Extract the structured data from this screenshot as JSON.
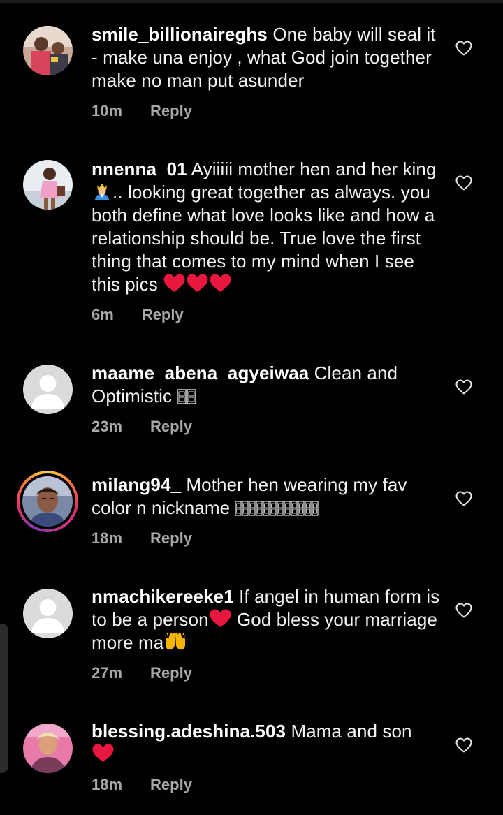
{
  "theme": {
    "background": "#000000",
    "username_color": "#ffffff",
    "meta_color": "#a8a8a8",
    "heart_color": "#e8173f",
    "story_ring": [
      "#ffcf40",
      "#f77737",
      "#e1306c",
      "#c13584",
      "#833ab4"
    ]
  },
  "comments": [
    {
      "username": "smile_billionaireghs",
      "text": "One baby will seal it -  make una enjoy , what God join together make no man put asunder",
      "time": "10m",
      "reply_label": "Reply",
      "avatar": "photo-two-men",
      "like_icon": "heart-outline-icon"
    },
    {
      "username": "nnenna_01",
      "text_parts": [
        "Ayiiiii mother hen and her king",
        ".. looking great together as always. you both define what love looks like and how a relationship should be. True love the first thing that comes to my mind when I see this pics "
      ],
      "emojis": [
        "prince-emoji",
        "red-heart-emoji",
        "red-heart-emoji",
        "red-heart-emoji"
      ],
      "time": "6m",
      "reply_label": "Reply",
      "avatar": "photo-woman-pink",
      "like_icon": "heart-outline-icon"
    },
    {
      "username": "maame_abena_agyeiwaa",
      "text": "Clean and Optimistic ",
      "emojis": [
        "missing-glyph",
        "missing-glyph"
      ],
      "time": "23m",
      "reply_label": "Reply",
      "avatar": "default-avatar",
      "like_icon": "heart-outline-icon"
    },
    {
      "username": "milang94_",
      "text": "Mother hen wearing my fav color n nickname ",
      "emojis": [
        "missing-glyph",
        "missing-glyph",
        "missing-glyph",
        "missing-glyph",
        "missing-glyph",
        "missing-glyph",
        "missing-glyph",
        "missing-glyph",
        "missing-glyph",
        "missing-glyph",
        "missing-glyph",
        "missing-glyph"
      ],
      "time": "18m",
      "reply_label": "Reply",
      "avatar": "photo-woman-selfie",
      "has_story": true,
      "like_icon": "heart-outline-icon"
    },
    {
      "username": "nmachikereeke1",
      "text_parts": [
        "If angel in human form is to be a person",
        " God bless your marriage more ma"
      ],
      "emojis": [
        "red-heart-emoji",
        "raising-hands-emoji"
      ],
      "time": "27m",
      "reply_label": "Reply",
      "avatar": "default-avatar",
      "like_icon": "heart-outline-icon"
    },
    {
      "username": "blessing.adeshina.503",
      "text": "Mama and son",
      "emojis": [
        "red-heart-emoji"
      ],
      "time": "18m",
      "reply_label": "Reply",
      "avatar": "photo-woman-pink-bg",
      "like_icon": "heart-outline-icon"
    }
  ]
}
